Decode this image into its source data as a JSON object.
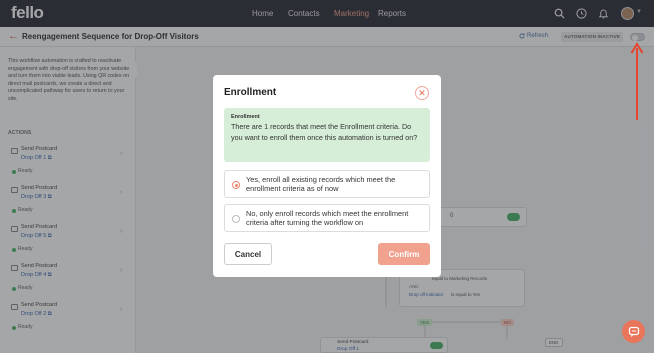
{
  "app": {
    "logo": "fello"
  },
  "nav": {
    "items": [
      "Home",
      "Contacts",
      "Marketing",
      "Reports"
    ],
    "active": "Marketing"
  },
  "header": {
    "title": "Reengagement Sequence for Drop-Off Visitors",
    "refresh_label": "Refresh",
    "status_label": "AUTOMATION INACTIVE",
    "toggle_on": false
  },
  "sidebar": {
    "description": "This workflow automation is crafted to reactivate engagement with drop-off visitors from your website and turn them into viable leads. Using QR codes on direct mail postcards, we create a direct and uncomplicated pathway for users to return to your site.",
    "actions_heading": "ACTIONS",
    "actions": [
      {
        "title": "Send Postcard",
        "link": "Drop Off 1",
        "status": "Ready"
      },
      {
        "title": "Send Postcard",
        "link": "Drop Off 3",
        "status": "Ready"
      },
      {
        "title": "Send Postcard",
        "link": "Drop Off 5",
        "status": "Ready"
      },
      {
        "title": "Send Postcard",
        "link": "Drop Off 4",
        "status": "Ready"
      },
      {
        "title": "Send Postcard",
        "link": "Drop Off 2",
        "status": "Ready"
      }
    ]
  },
  "canvas": {
    "node_count": "0",
    "condition_text": "equal to  Marketing Records",
    "condition_and": "AND",
    "condition_field": "Drop off Indicator",
    "condition_value": "is equal to  Yes",
    "yes_label": "YES",
    "no_label": "NO",
    "end_label": "END",
    "bottom_node_title": "Send Postcard",
    "bottom_node_link": "Drop Off 1"
  },
  "modal": {
    "title": "Enrollment",
    "info_heading": "Enrollment",
    "info_text": "There are 1 records that meet the Enrollment criteria. Do you want to enroll them once this automation is turned on?",
    "options": [
      {
        "label": "Yes, enroll all existing records which meet the enrollment criteria as of now",
        "selected": true
      },
      {
        "label": "No, only enroll records which meet the enrollment criteria after turning the workflow on",
        "selected": false
      }
    ],
    "cancel_label": "Cancel",
    "confirm_label": "Confirm"
  },
  "colors": {
    "brand": "#e9755a",
    "nav_bg": "#2b2f3a",
    "info_bg": "#d6edd7",
    "annotation_arrow": "#e8442e",
    "ready": "#4db36c"
  },
  "icons": [
    "search-icon",
    "clock-icon",
    "bell-icon",
    "chevron-down-icon",
    "back-arrow-icon",
    "refresh-icon",
    "close-icon",
    "chat-help-icon"
  ]
}
